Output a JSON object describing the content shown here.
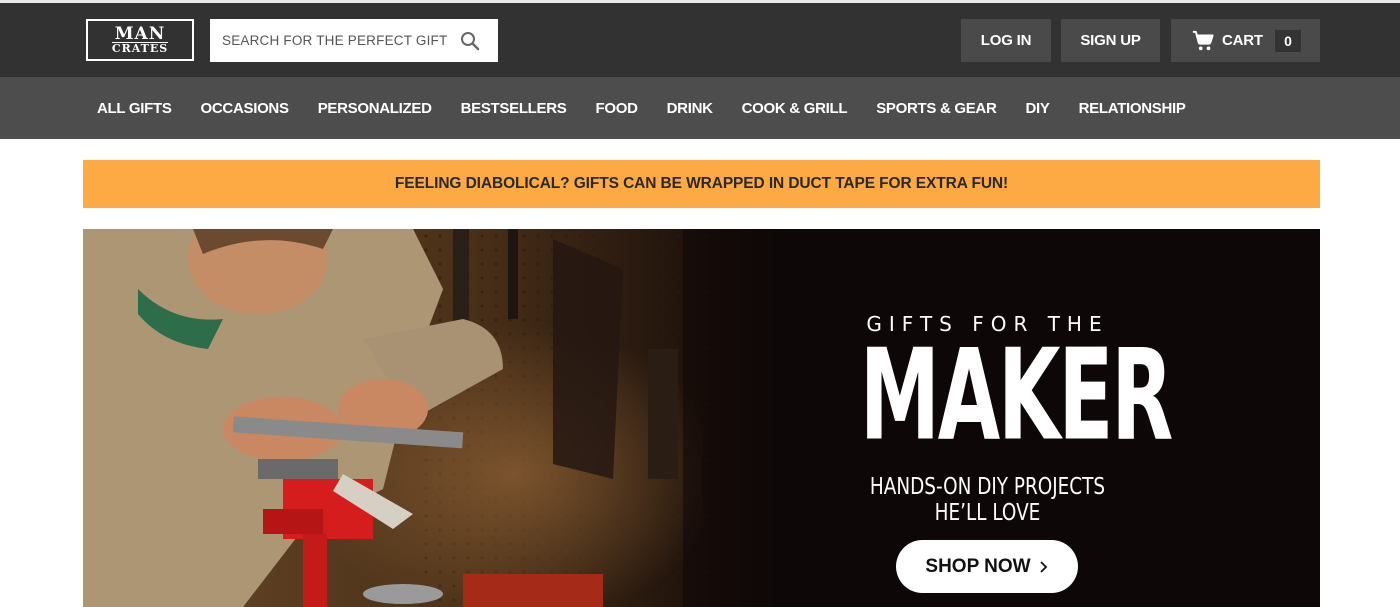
{
  "header": {
    "logo": {
      "line1": "MAN",
      "line2": "CRATES"
    },
    "search": {
      "placeholder": "SEARCH FOR THE PERFECT GIFT",
      "value": "",
      "icon": "search-icon"
    },
    "login_label": "LOG IN",
    "signup_label": "SIGN UP",
    "cart": {
      "label": "CART",
      "count": "0",
      "icon": "cart-icon"
    }
  },
  "nav": {
    "items": [
      "ALL GIFTS",
      "OCCASIONS",
      "PERSONALIZED",
      "BESTSELLERS",
      "FOOD",
      "DRINK",
      "COOK & GRILL",
      "SPORTS & GEAR",
      "DIY",
      "RELATIONSHIP"
    ]
  },
  "promo": {
    "text": "FEELING DIABOLICAL? GIFTS CAN BE WRAPPED IN DUCT TAPE FOR EXTRA FUN!"
  },
  "hero": {
    "eyebrow": "GIFTS FOR THE",
    "title": "MAKER",
    "subtitle": "HANDS-ON DIY PROJECTS HE’LL LOVE",
    "cta_label": "SHOP NOW",
    "cta_icon": "chevron-right-icon"
  },
  "colors": {
    "topbar": "#323232",
    "nav": "#4d4d4d",
    "button": "#4a4a4a",
    "promo": "#fdaa45",
    "hero_bg": "#0e0707"
  }
}
